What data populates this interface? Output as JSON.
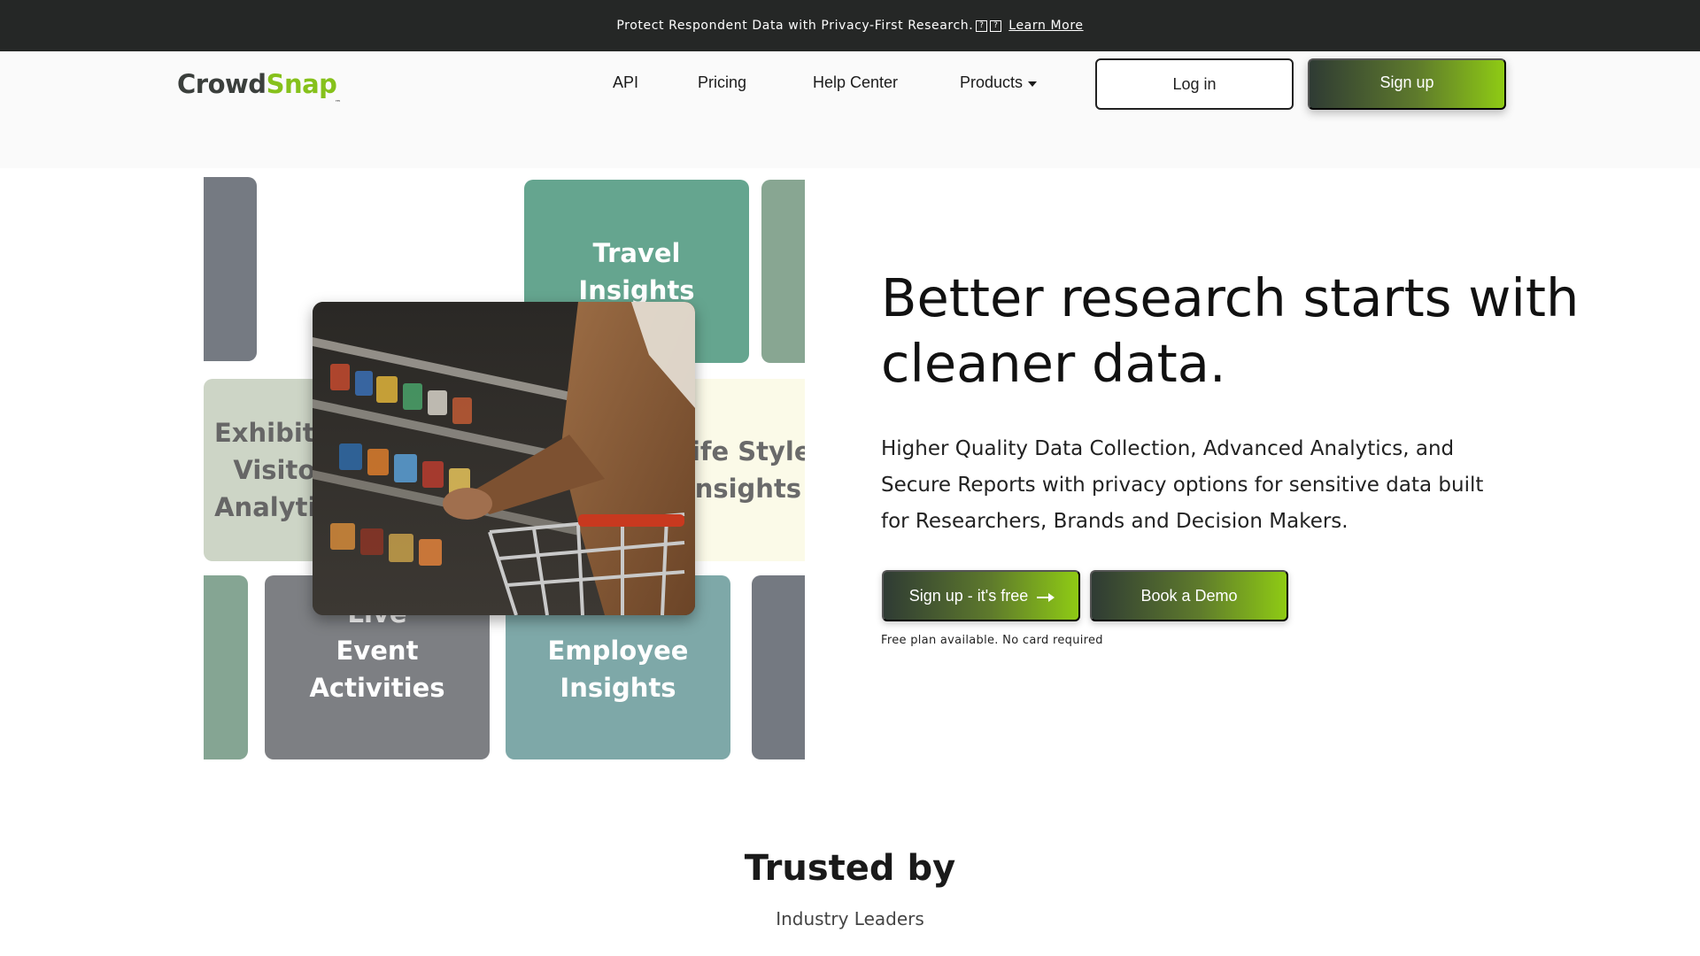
{
  "announcement": {
    "text": "Protect Respondent Data with Privacy-First Research.",
    "icon_glyph_1": "?",
    "icon_glyph_2": "?",
    "link": "Learn More"
  },
  "brand": {
    "name_part_1": "Crowd",
    "name_part_2": "Snap",
    "trademark": "™",
    "color_dark": "#3b3f3c",
    "color_accent": "#86c11b"
  },
  "nav": {
    "items": [
      {
        "label": "API"
      },
      {
        "label": "Pricing"
      },
      {
        "label": "Help Center"
      },
      {
        "label": "Products"
      }
    ],
    "login": "Log in",
    "signup": "Sign up"
  },
  "collage": {
    "tiles": [
      {
        "label": "Travel Insights"
      },
      {
        "label": "Exhibition Visitor Analytics"
      },
      {
        "label": "Life Style Insights"
      },
      {
        "label": "Live Event Activities"
      },
      {
        "label": "Employee Insights"
      }
    ]
  },
  "hero": {
    "title": "Better research starts with cleaner data.",
    "subtitle": "Higher Quality Data Collection, Advanced Analytics, and Secure Reports with privacy options for sensitive data built for Researchers, Brands and Decision Makers.",
    "cta_primary": "Sign up - it's free",
    "cta_secondary": "Book a Demo",
    "note": "Free plan available. No card required"
  },
  "trusted": {
    "title": "Trusted by",
    "subtitle": "Industry Leaders"
  },
  "colors": {
    "topbar": "#252726",
    "gradient_start": "#2f3b34",
    "gradient_end": "#8fcb14"
  }
}
